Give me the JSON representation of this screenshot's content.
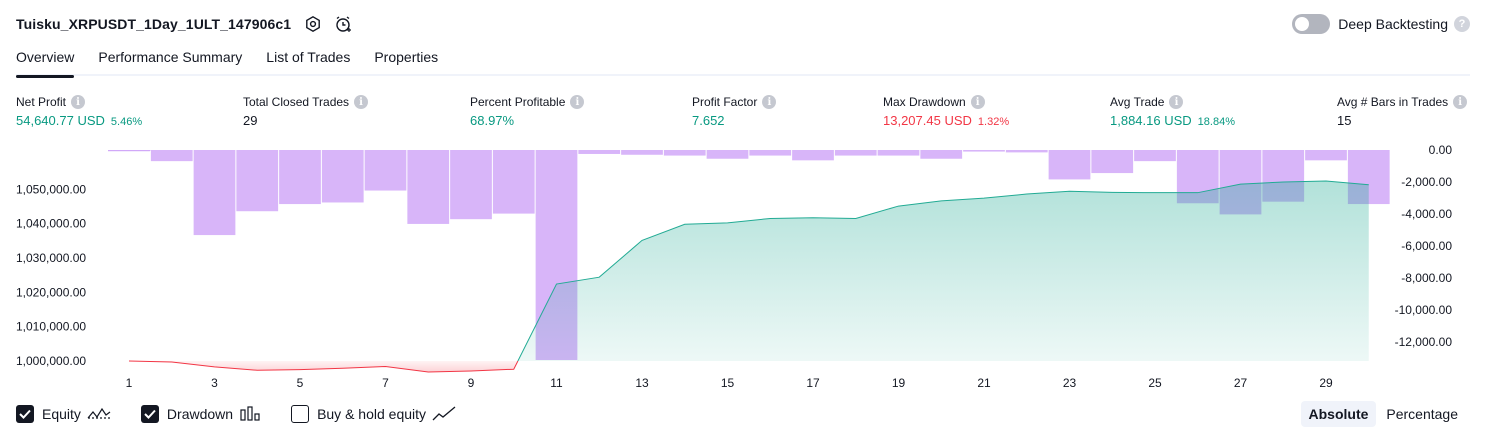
{
  "header": {
    "strategy_name": "Tuisku_XRPUSDT_1Day_1ULT_147906c1",
    "deep_backtesting_label": "Deep Backtesting",
    "deep_backtesting_enabled": false
  },
  "tabs": [
    {
      "label": "Overview",
      "active": true
    },
    {
      "label": "Performance Summary",
      "active": false
    },
    {
      "label": "List of Trades",
      "active": false
    },
    {
      "label": "Properties",
      "active": false
    }
  ],
  "metrics": {
    "net_profit": {
      "label": "Net Profit",
      "value": "54,640.77 USD",
      "pct": "5.46%"
    },
    "total_closed_trades": {
      "label": "Total Closed Trades",
      "value": "29"
    },
    "percent_profitable": {
      "label": "Percent Profitable",
      "value": "68.97%"
    },
    "profit_factor": {
      "label": "Profit Factor",
      "value": "7.652"
    },
    "max_drawdown": {
      "label": "Max Drawdown",
      "value": "13,207.45 USD",
      "pct": "1.32%"
    },
    "avg_trade": {
      "label": "Avg Trade",
      "value": "1,884.16 USD",
      "pct": "18.84%"
    },
    "avg_bars": {
      "label": "Avg # Bars in Trades",
      "value": "15"
    }
  },
  "colors": {
    "positive": "#089981",
    "negative": "#f23645",
    "equity_line_up": "#22ab94",
    "equity_line_down": "#f23645",
    "drawdown_bar": "#d1a8f8"
  },
  "chart_data": {
    "type": "line",
    "x": [
      1,
      2,
      3,
      4,
      5,
      6,
      7,
      8,
      9,
      10,
      11,
      12,
      13,
      14,
      15,
      16,
      17,
      18,
      19,
      20,
      21,
      22,
      23,
      24,
      25,
      26,
      27,
      28,
      29,
      30
    ],
    "x_tick_labels": [
      "1",
      "3",
      "5",
      "7",
      "9",
      "11",
      "13",
      "15",
      "17",
      "19",
      "21",
      "23",
      "25",
      "27",
      "29"
    ],
    "series": [
      {
        "type": "line",
        "axis": "left",
        "values": [
          1000000,
          999700,
          998300,
          997300,
          997500,
          997900,
          998400,
          996800,
          997100,
          997600,
          1022400,
          1024400,
          1035100,
          1039800,
          1040200,
          1041500,
          1041700,
          1041500,
          1045100,
          1046600,
          1047400,
          1048600,
          1049400,
          1049100,
          1049000,
          1049000,
          1051500,
          1052100,
          1052400,
          1051300
        ]
      },
      {
        "type": "bar",
        "axis": "right",
        "values": [
          -80,
          -700,
          -5350,
          -3850,
          -3400,
          -3300,
          -2550,
          -4650,
          -4350,
          -4000,
          -13207,
          -250,
          -300,
          -350,
          -550,
          -350,
          -650,
          -350,
          -350,
          -550,
          -100,
          -150,
          -1850,
          -1450,
          -700,
          -3350,
          -4050,
          -3250,
          -650,
          -3400
        ]
      }
    ],
    "y_left_ticks": [
      "1,000,000.00",
      "1,010,000.00",
      "1,020,000.00",
      "1,030,000.00",
      "1,040,000.00",
      "1,050,000.00"
    ],
    "y_right_ticks": [
      "0.00",
      "-2,000.00",
      "-4,000.00",
      "-6,000.00",
      "-8,000.00",
      "-10,000.00",
      "-12,000.00"
    ],
    "y_left_range": [
      993000,
      1056000
    ],
    "y_right_range": [
      -13207,
      0
    ],
    "grid": false
  },
  "legend": {
    "items": [
      {
        "label": "Equity",
        "checked": true
      },
      {
        "label": "Drawdown",
        "checked": true
      },
      {
        "label": "Buy & hold equity",
        "checked": false
      }
    ]
  },
  "mode": {
    "options": [
      "Absolute",
      "Percentage"
    ],
    "selected": "Absolute"
  }
}
